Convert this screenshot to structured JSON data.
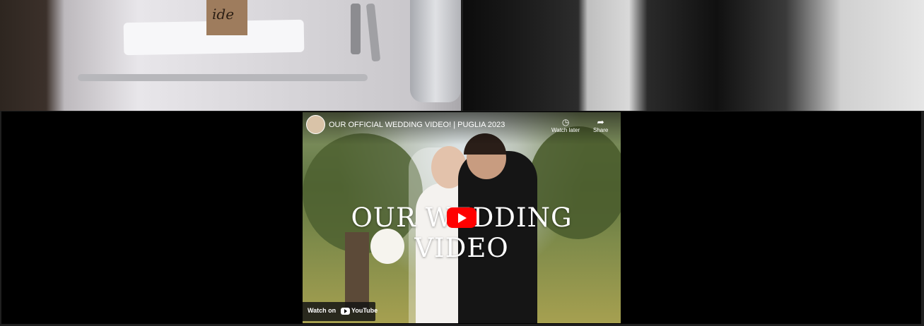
{
  "top_left_image": {
    "card_text": "ide"
  },
  "video": {
    "channel_title": "OUR OFFICIAL WEDDING VIDEO! | PUGLIA 2023",
    "overlay_title": "OUR WEDDING VIDEO",
    "watch_later_label": "Watch later",
    "share_label": "Share",
    "watch_on_label": "Watch on",
    "youtube_label": "YouTube",
    "icons": {
      "watch_later": "clock-icon",
      "share": "share-arrow-icon",
      "play": "play-icon"
    }
  }
}
